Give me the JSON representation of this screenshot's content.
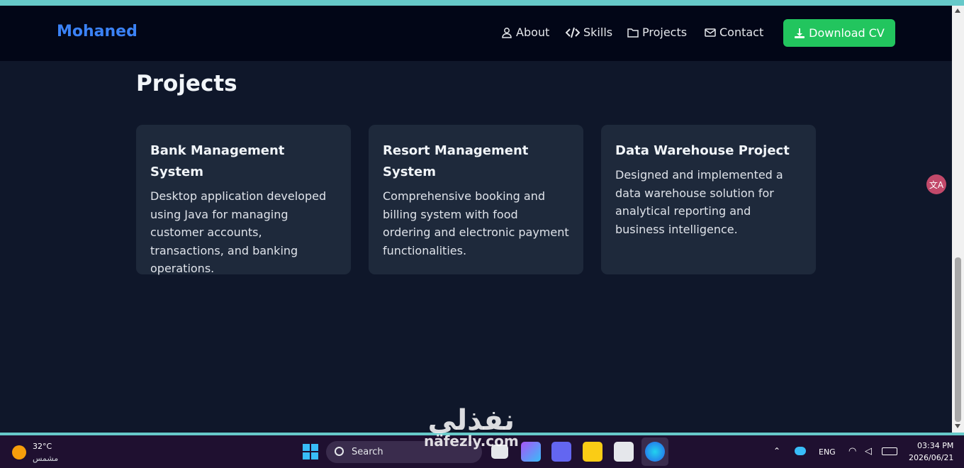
{
  "navbar": {
    "brand": "Mohaned",
    "links": [
      {
        "label": "About",
        "icon": "user-icon"
      },
      {
        "label": "Skills",
        "icon": "code-icon"
      },
      {
        "label": "Projects",
        "icon": "folder-icon"
      },
      {
        "label": "Contact",
        "icon": "envelope-icon"
      }
    ],
    "download_button": {
      "label": "Download CV",
      "icon": "download-icon"
    }
  },
  "section": {
    "title": "Projects"
  },
  "projects": [
    {
      "title": "Bank Management System",
      "description": "Desktop application developed using Java for managing customer accounts, transactions, and banking operations."
    },
    {
      "title": "Resort Management System",
      "description": "Comprehensive booking and billing system with food ordering and electronic payment functionalities."
    },
    {
      "title": "Data Warehouse Project",
      "description": "Designed and implemented a data warehouse solution for analytical reporting and business intelligence."
    }
  ],
  "watermark": {
    "arabic": "نفذلي",
    "latin": "nafezly.com"
  },
  "taskbar": {
    "weather_temp": "32°C",
    "weather_desc": "مشمس",
    "search_label": "Search",
    "language": "ENG",
    "time": "03:34 PM",
    "date": "2026/06/21"
  },
  "colors": {
    "brand": "#3b82f6",
    "download_button": "#22c55e",
    "page_background": "#0f172a",
    "card_background": "#1e293b"
  }
}
